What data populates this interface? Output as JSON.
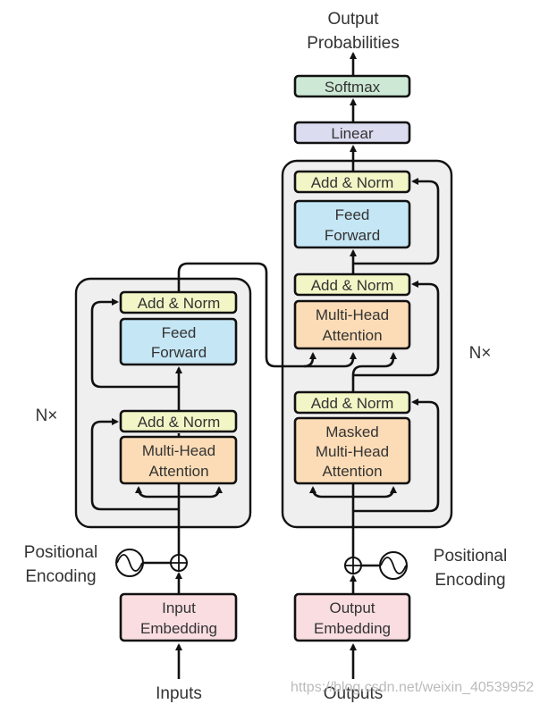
{
  "output_label": [
    "Output",
    "Probabilities"
  ],
  "softmax": "Softmax",
  "linear": "Linear",
  "encoder": {
    "repeat": "N×",
    "add_norm_top": "Add & Norm",
    "feed_forward": [
      "Feed",
      "Forward"
    ],
    "add_norm_bottom": "Add & Norm",
    "attention": [
      "Multi-Head",
      "Attention"
    ],
    "positional_encoding": [
      "Positional",
      "Encoding"
    ],
    "embedding": [
      "Input",
      "Embedding"
    ],
    "input_label": "Inputs"
  },
  "decoder": {
    "repeat": "N×",
    "add_norm_top": "Add & Norm",
    "feed_forward": [
      "Feed",
      "Forward"
    ],
    "add_norm_mid": "Add & Norm",
    "attention": [
      "Multi-Head",
      "Attention"
    ],
    "add_norm_bottom": "Add & Norm",
    "masked_attention": [
      "Masked",
      "Multi-Head",
      "Attention"
    ],
    "positional_encoding": [
      "Positional",
      "Encoding"
    ],
    "embedding": [
      "Output",
      "Embedding"
    ],
    "input_label": "Outputs"
  },
  "colors": {
    "add_norm": "#f2f6c6",
    "feed_forward": "#c5e6f5",
    "attention": "#fcdcb6",
    "embedding": "#f9dde1",
    "linear": "#dcdcf1",
    "softmax": "#cde9d5",
    "block": "#efefef"
  },
  "watermark": "https://blog.csdn.net/weixin_40539952"
}
